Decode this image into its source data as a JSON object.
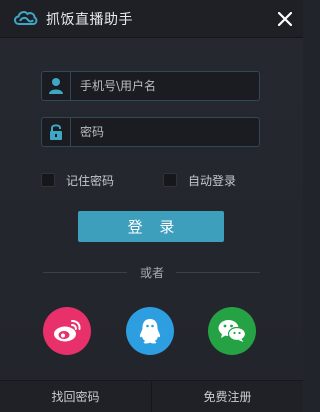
{
  "window": {
    "title": "抓饭直播助手",
    "logo_icon": "cloud-logo-icon",
    "close_icon": "close-icon"
  },
  "login_form": {
    "username_placeholder": "手机号\\用户名",
    "username_value": "",
    "username_icon": "user-icon",
    "password_placeholder": "密码",
    "password_value": "",
    "password_icon": "lock-icon",
    "remember_password_label": "记住密码",
    "remember_password_checked": false,
    "auto_login_label": "自动登录",
    "auto_login_checked": false,
    "login_button_label": "登 录"
  },
  "divider": {
    "text": "或者"
  },
  "social_logins": [
    {
      "name": "weibo",
      "icon": "weibo-icon",
      "color": "#e8306a"
    },
    {
      "name": "qq",
      "icon": "qq-icon",
      "color": "#2d9fe0"
    },
    {
      "name": "wechat",
      "icon": "wechat-icon",
      "color": "#25a244"
    }
  ],
  "footer": {
    "retrieve_password_label": "找回密码",
    "register_label": "免费注册"
  },
  "colors": {
    "accent": "#3d9fbc",
    "background": "#22242b",
    "field_border": "#2f4a55"
  }
}
